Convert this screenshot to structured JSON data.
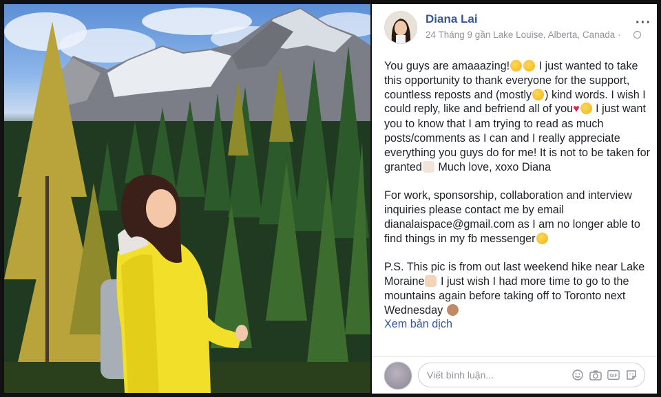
{
  "post": {
    "author": "Diana Lai",
    "meta": "24 Tháng 9 gần Lake Louise, Alberta, Canada ·",
    "more_icon": "more-horizontal-icon",
    "privacy_icon": "globe-icon",
    "p1_a": "You guys are amaaazing!",
    "p1_b": " I just wanted to take this opportunity to thank everyone for the support, countless reposts and (mostly",
    "p1_c": ") kind words. I wish I could reply, like and befriend all of you",
    "p1_d": " I just want you to know that I am trying to read as much posts/comments as I can and I really appreciate everything you guys do for me! It is not to be taken for granted",
    "p1_e": " Much love, xoxo Diana",
    "p2": "For work, sponsorship, collaboration and interview inquiries please contact me by email dianalaispace@gmail.com as I am no longer able to find things in my fb messenger",
    "p3_a": "P.S. This pic is from out last weekend hike near Lake Moraine",
    "p3_b": " I just wish I had more time to go to the mountains again before taking off to Toronto next Wednesday ",
    "translate": "Xem bản dịch"
  },
  "comment": {
    "placeholder": "Viết bình luận...",
    "icons": [
      "emoji-icon",
      "camera-icon",
      "gif-icon",
      "sticker-icon"
    ],
    "gif_label": "GIF"
  },
  "colors": {
    "link": "#365899",
    "text": "#1d2129",
    "muted": "#90949c"
  }
}
